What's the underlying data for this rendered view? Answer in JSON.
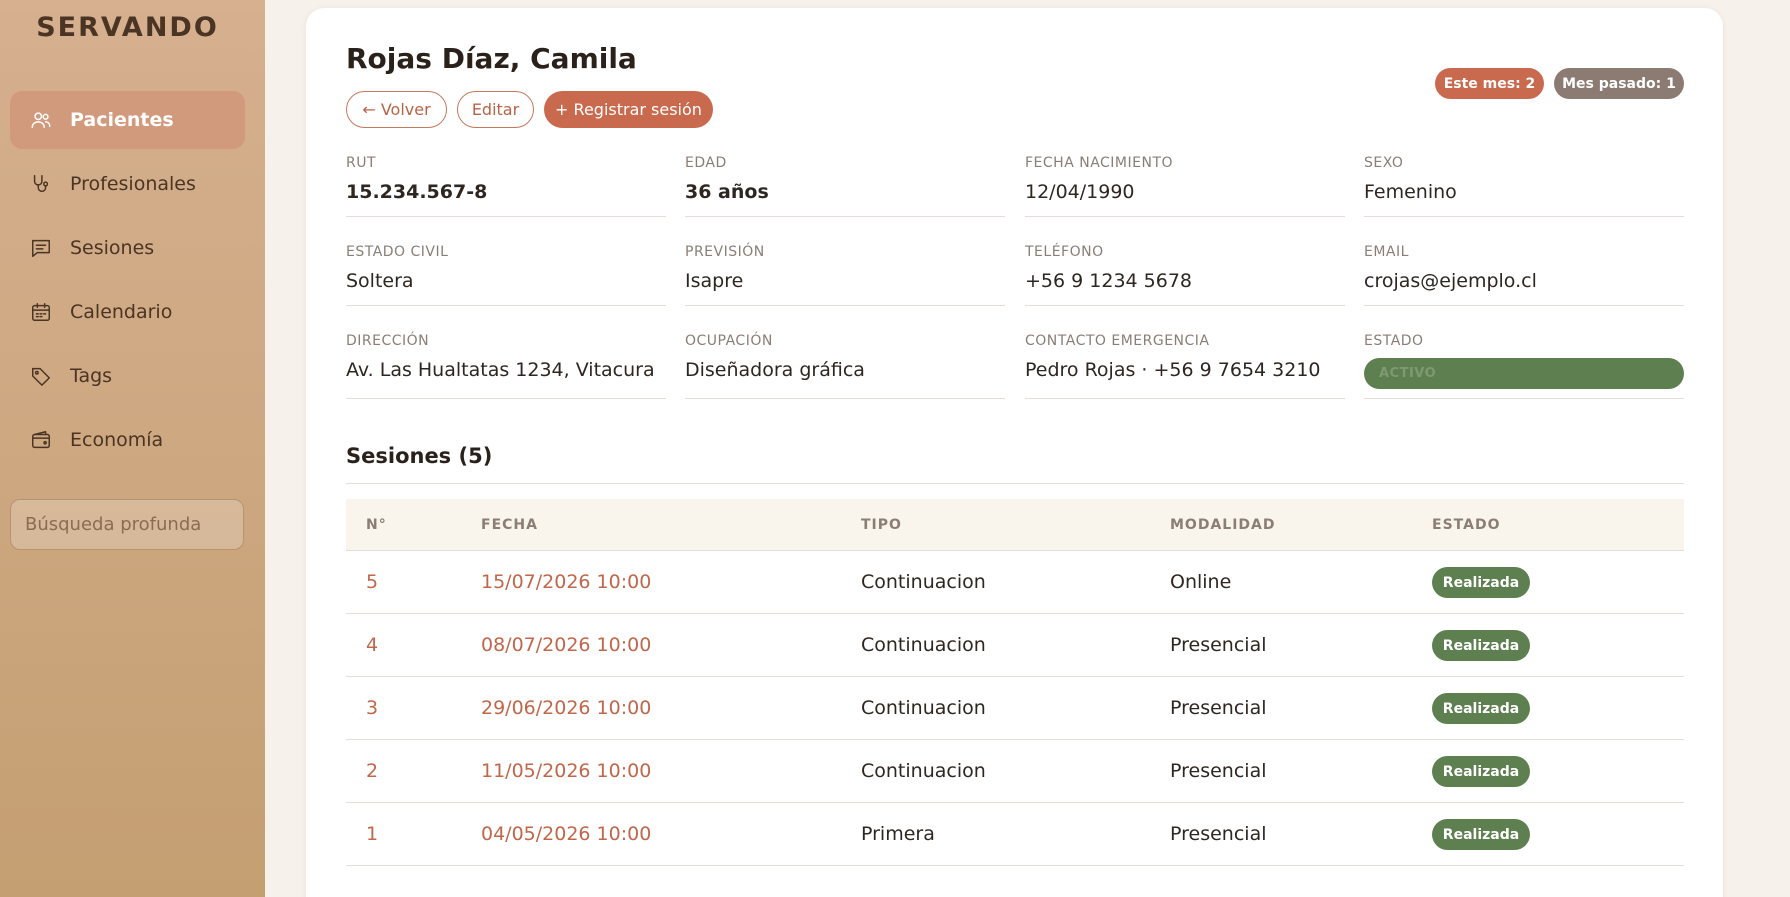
{
  "app": {
    "brand": "SERVANDO"
  },
  "sidebar": {
    "items": [
      {
        "label": "Pacientes",
        "icon": "users-icon",
        "active": true
      },
      {
        "label": "Profesionales",
        "icon": "stethoscope-icon",
        "active": false
      },
      {
        "label": "Sesiones",
        "icon": "chat-icon",
        "active": false
      },
      {
        "label": "Calendario",
        "icon": "calendar-icon",
        "active": false
      },
      {
        "label": "Tags",
        "icon": "tag-icon",
        "active": false
      },
      {
        "label": "Economía",
        "icon": "wallet-icon",
        "active": false
      }
    ],
    "search_placeholder": "Búsqueda profunda"
  },
  "patient": {
    "name": "Rojas Díaz, Camila",
    "actions": {
      "back": "← Volver",
      "edit": "Editar",
      "register": "+ Registrar sesión"
    },
    "stats": {
      "this_month": "Este mes: 2",
      "last_month": "Mes pasado: 1"
    },
    "fields": {
      "rut": {
        "label": "RUT",
        "value": "15.234.567-8"
      },
      "edad": {
        "label": "EDAD",
        "value": "36 años"
      },
      "fecha_nacimiento": {
        "label": "FECHA NACIMIENTO",
        "value": "12/04/1990"
      },
      "sexo": {
        "label": "SEXO",
        "value": "Femenino"
      },
      "estado_civil": {
        "label": "ESTADO CIVIL",
        "value": "Soltera"
      },
      "prevision": {
        "label": "PREVISIÓN",
        "value": "Isapre"
      },
      "telefono": {
        "label": "TELÉFONO",
        "value": "+56 9 1234 5678"
      },
      "email": {
        "label": "EMAIL",
        "value": "crojas@ejemplo.cl"
      },
      "direccion": {
        "label": "DIRECCIÓN",
        "value": "Av. Las Hualtatas 1234, Vitacura"
      },
      "ocupacion": {
        "label": "OCUPACIÓN",
        "value": "Diseñadora gráfica"
      },
      "contacto_emergencia": {
        "label": "CONTACTO EMERGENCIA",
        "value": "Pedro Rojas · +56 9 7654 3210"
      },
      "estado": {
        "label": "ESTADO",
        "value": "ACTIVO"
      }
    }
  },
  "sessions": {
    "title": "Sesiones (5)",
    "headers": {
      "num": "N°",
      "fecha": "FECHA",
      "tipo": "TIPO",
      "modalidad": "MODALIDAD",
      "estado": "ESTADO"
    },
    "rows": [
      {
        "num": "5",
        "fecha": "15/07/2026 10:00",
        "tipo": "Continuacion",
        "modalidad": "Online",
        "estado": "Realizada"
      },
      {
        "num": "4",
        "fecha": "08/07/2026 10:00",
        "tipo": "Continuacion",
        "modalidad": "Presencial",
        "estado": "Realizada"
      },
      {
        "num": "3",
        "fecha": "29/06/2026 10:00",
        "tipo": "Continuacion",
        "modalidad": "Presencial",
        "estado": "Realizada"
      },
      {
        "num": "2",
        "fecha": "11/05/2026 10:00",
        "tipo": "Continuacion",
        "modalidad": "Presencial",
        "estado": "Realizada"
      },
      {
        "num": "1",
        "fecha": "04/05/2026 10:00",
        "tipo": "Primera",
        "modalidad": "Presencial",
        "estado": "Realizada"
      }
    ]
  },
  "colors": {
    "accent": "#c96a4f",
    "success": "#5e7f4f",
    "neutral_pill": "#8b7b72",
    "sidebar_active": "#d19a7c"
  }
}
